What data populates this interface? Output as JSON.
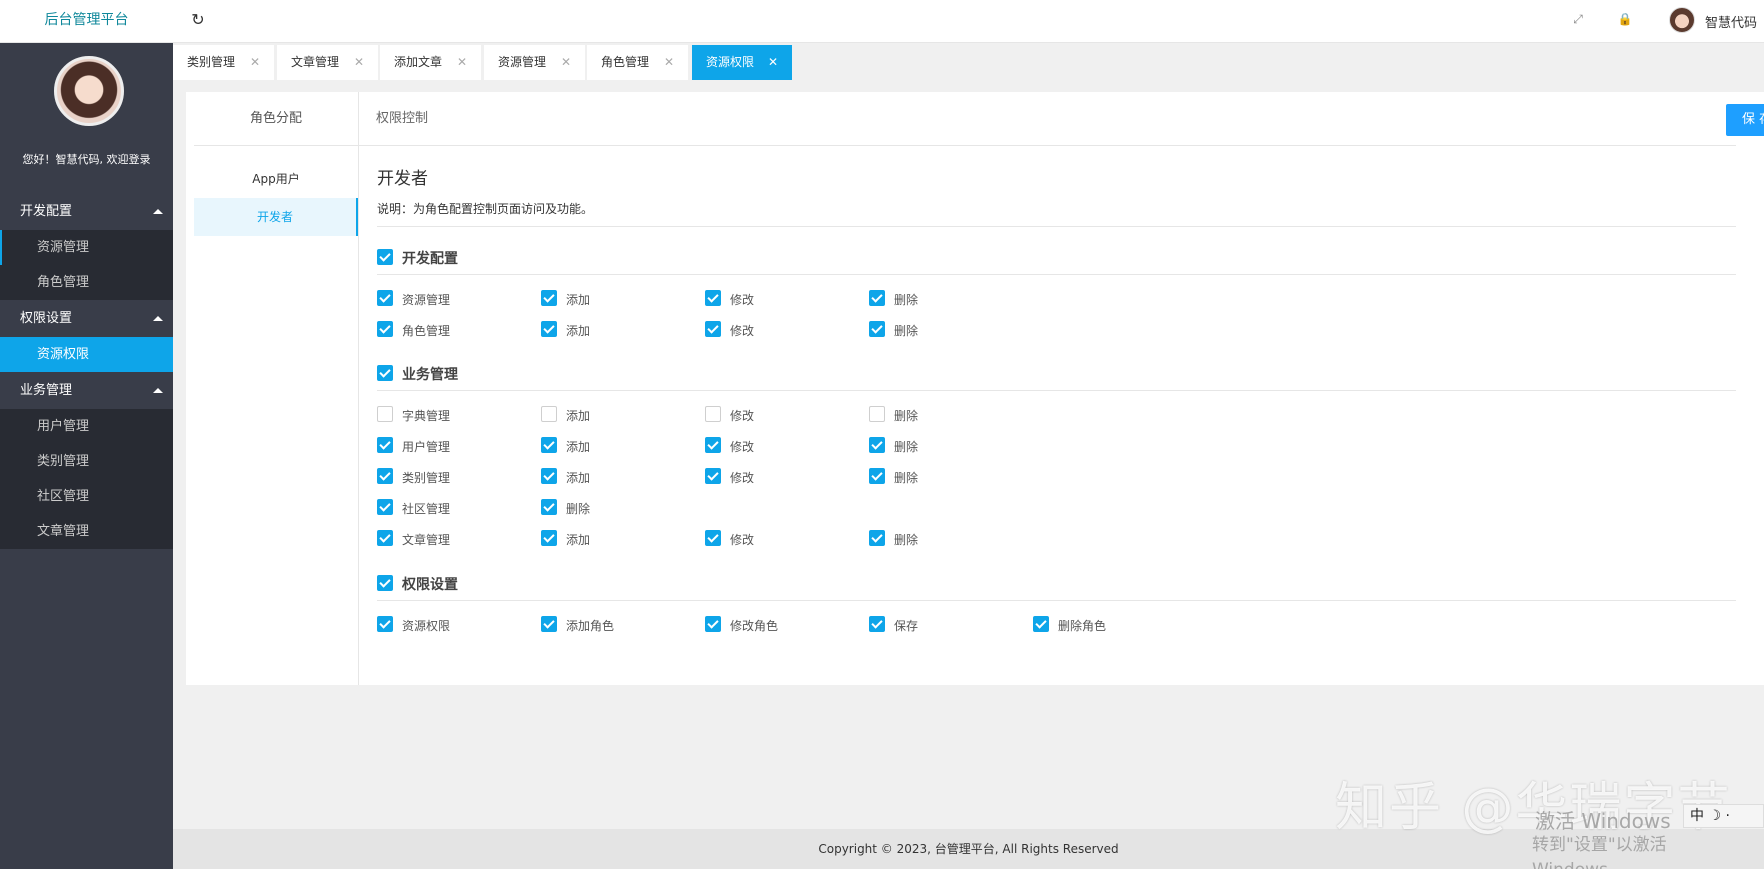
{
  "app": {
    "title": "后台管理平台"
  },
  "header": {
    "username": "智慧代码",
    "refresh_icon": "↻",
    "fullscreen_icon": "⤢",
    "lock_icon": "🔒"
  },
  "sidebar": {
    "greeting": "您好！智慧代码, 欢迎登录",
    "groups": [
      {
        "label": "开发配置",
        "items": [
          "资源管理",
          "角色管理"
        ]
      },
      {
        "label": "权限设置",
        "items": [
          "资源权限"
        ]
      },
      {
        "label": "业务管理",
        "items": [
          "用户管理",
          "类别管理",
          "社区管理",
          "文章管理"
        ]
      }
    ]
  },
  "tabs": [
    "类别管理",
    "文章管理",
    "添加文章",
    "资源管理",
    "角色管理",
    "资源权限"
  ],
  "tab_close": "✕",
  "content": {
    "left_header": "角色分配",
    "right_header": "权限控制",
    "save_button": "保 存",
    "roles": [
      "App用户",
      "开发者"
    ],
    "role_title": "开发者",
    "description": "说明：为角色配置控制页面访问及功能。",
    "groups": [
      {
        "label": "开发配置",
        "checked": true,
        "rows": [
          [
            {
              "label": "资源管理",
              "checked": true
            },
            {
              "label": "添加",
              "checked": true
            },
            {
              "label": "修改",
              "checked": true
            },
            {
              "label": "删除",
              "checked": true
            }
          ],
          [
            {
              "label": "角色管理",
              "checked": true
            },
            {
              "label": "添加",
              "checked": true
            },
            {
              "label": "修改",
              "checked": true
            },
            {
              "label": "删除",
              "checked": true
            }
          ]
        ]
      },
      {
        "label": "业务管理",
        "checked": true,
        "rows": [
          [
            {
              "label": "字典管理",
              "checked": false
            },
            {
              "label": "添加",
              "checked": false
            },
            {
              "label": "修改",
              "checked": false
            },
            {
              "label": "删除",
              "checked": false
            }
          ],
          [
            {
              "label": "用户管理",
              "checked": true
            },
            {
              "label": "添加",
              "checked": true
            },
            {
              "label": "修改",
              "checked": true
            },
            {
              "label": "删除",
              "checked": true
            }
          ],
          [
            {
              "label": "类别管理",
              "checked": true
            },
            {
              "label": "添加",
              "checked": true
            },
            {
              "label": "修改",
              "checked": true
            },
            {
              "label": "删除",
              "checked": true
            }
          ],
          [
            {
              "label": "社区管理",
              "checked": true
            },
            {
              "label": "删除",
              "checked": true
            }
          ],
          [
            {
              "label": "文章管理",
              "checked": true
            },
            {
              "label": "添加",
              "checked": true
            },
            {
              "label": "修改",
              "checked": true
            },
            {
              "label": "删除",
              "checked": true
            }
          ]
        ]
      },
      {
        "label": "权限设置",
        "checked": true,
        "rows": [
          [
            {
              "label": "资源权限",
              "checked": true
            },
            {
              "label": "添加角色",
              "checked": true
            },
            {
              "label": "修改角色",
              "checked": true
            },
            {
              "label": "保存",
              "checked": true
            },
            {
              "label": "删除角色",
              "checked": true
            }
          ]
        ]
      }
    ]
  },
  "footer": {
    "copyright": "Copyright © 2023, 台管理平台, All Rights Reserved"
  },
  "overlay": {
    "watermark": "知乎 @华瑞字节",
    "activate_line1": "激活 Windows",
    "activate_line2": "转到\"设置\"以激活 Windows。",
    "ime": "中 ☽ ·"
  },
  "colors": {
    "accent": "#0ea5e9",
    "sidebar_bg": "#393d49",
    "brand": "#10889b",
    "save": "#1e9fff"
  }
}
